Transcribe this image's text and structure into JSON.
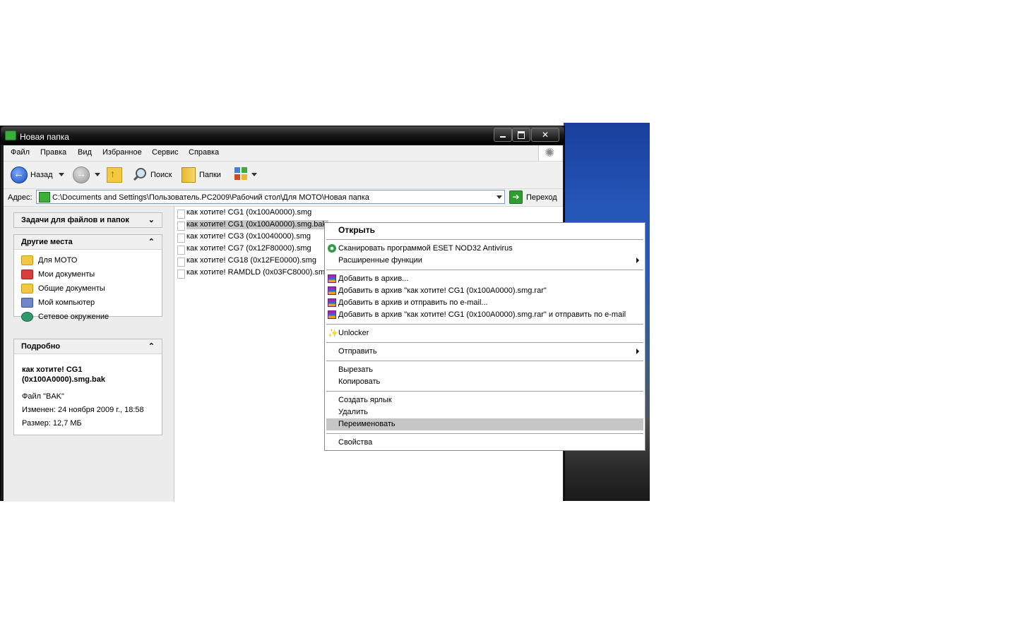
{
  "window": {
    "title": "Новая папка",
    "menu": [
      "Файл",
      "Правка",
      "Вид",
      "Избранное",
      "Сервис",
      "Справка"
    ]
  },
  "toolbar": {
    "back_label": "Назад",
    "search_label": "Поиск",
    "folders_label": "Папки"
  },
  "address": {
    "label": "Адрес:",
    "value": "C:\\Documents and Settings\\Пользователь.PC2009\\Рабочий стол\\Для МОТО\\Новая папка",
    "go_label": "Переход"
  },
  "left_pane": {
    "tasks_title": "Задачи для файлов и папок",
    "places_title": "Другие места",
    "places": [
      {
        "label": "Для МОТО",
        "icon": "folder-icon",
        "color": "#f3c744"
      },
      {
        "label": "Мои документы",
        "icon": "my-documents-icon",
        "color": "#d9403a"
      },
      {
        "label": "Общие документы",
        "icon": "folder-icon",
        "color": "#f3c744"
      },
      {
        "label": "Мой компьютер",
        "icon": "computer-icon",
        "color": "#6f86c9"
      },
      {
        "label": "Сетевое окружение",
        "icon": "network-icon",
        "color": "#2f9a6a"
      }
    ],
    "details_title": "Подробно",
    "details": {
      "name_line1": "как хотите! CG1",
      "name_line2": "(0x100A0000).smg.bak",
      "type": "Файл \"BAK\"",
      "modified": "Изменен: 24 ноября 2009 г., 18:58",
      "size": "Размер: 12,7 МБ"
    }
  },
  "files": [
    {
      "name": "как хотите! CG1 (0x100A0000).smg",
      "selected": false
    },
    {
      "name": "как хотите! CG1 (0x100A0000).smg.bak",
      "selected": true
    },
    {
      "name": "как хотите! CG3 (0x10040000).smg",
      "selected": false
    },
    {
      "name": "как хотите! CG7 (0x12F80000).smg",
      "selected": false
    },
    {
      "name": "как хотите! CG18 (0x12FE0000).smg",
      "selected": false
    },
    {
      "name": "как хотите! RAMDLD (0x03FC8000).smg",
      "selected": false
    }
  ],
  "context_menu": {
    "open": "Открыть",
    "scan": "Сканировать программой ESET NOD32 Antivirus",
    "advanced": "Расширенные функции",
    "add_archive": "Добавить в архив...",
    "add_archive_named": "Добавить в архив \"как хотите! CG1 (0x100A0000).smg.rar\"",
    "add_archive_email": "Добавить в архив и отправить по e-mail...",
    "add_archive_named_email": "Добавить в архив \"как хотите! CG1 (0x100A0000).smg.rar\" и отправить по e-mail",
    "unlocker": "Unlocker",
    "send_to": "Отправить",
    "cut": "Вырезать",
    "copy": "Копировать",
    "create_shortcut": "Создать ярлык",
    "delete": "Удалить",
    "rename": "Переименовать",
    "properties": "Свойства",
    "highlighted": "rename"
  }
}
